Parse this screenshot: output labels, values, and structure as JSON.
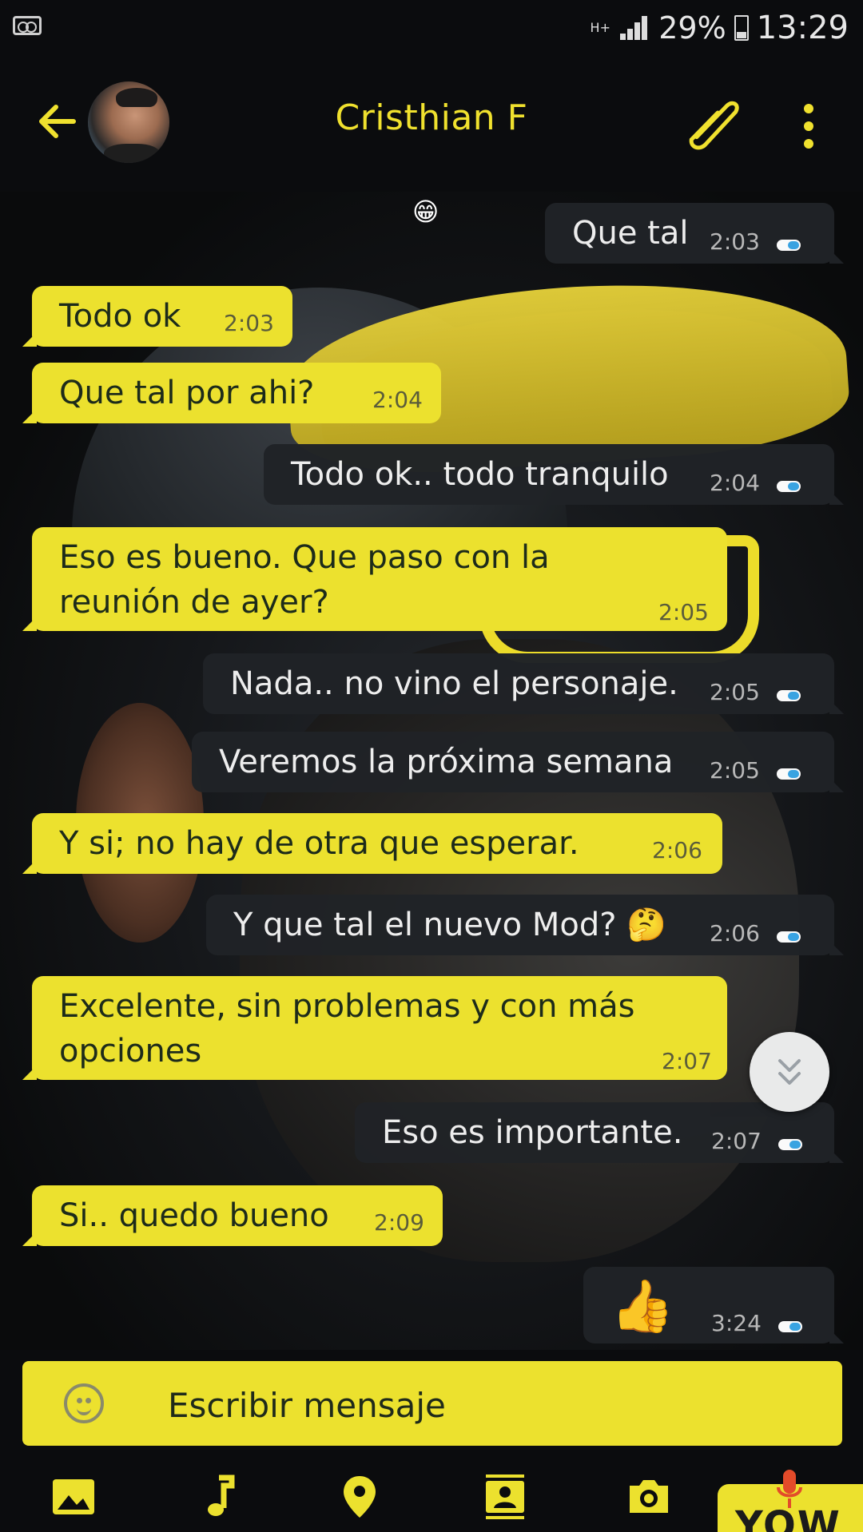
{
  "status_bar": {
    "network": "H+",
    "battery": "29%",
    "time": "13:29"
  },
  "header": {
    "contact_name": "Cristhian F"
  },
  "colors": {
    "accent_yellow": "#ece12e",
    "outgoing_bubble": "#202327",
    "read_tick_blue": "#3aa6e6"
  },
  "messages": [
    {
      "dir": "out",
      "text": "Que tal",
      "time": "2:03"
    },
    {
      "dir": "in",
      "text": "Todo ok",
      "time": "2:03"
    },
    {
      "dir": "in",
      "text": "Que tal por ahi?",
      "time": "2:04"
    },
    {
      "dir": "out",
      "text": "Todo ok.. todo tranquilo",
      "time": "2:04"
    },
    {
      "dir": "in",
      "text": "Eso es bueno. Que paso con la reunión de ayer?",
      "time": "2:05"
    },
    {
      "dir": "out",
      "text": "Nada.. no vino el personaje.",
      "time": "2:05"
    },
    {
      "dir": "out",
      "text": "Veremos la próxima semana",
      "time": "2:05"
    },
    {
      "dir": "in",
      "text": "Y si; no hay de otra que esperar.",
      "time": "2:06"
    },
    {
      "dir": "out",
      "text": "Y que tal el nuevo Mod? 🤔",
      "time": "2:06"
    },
    {
      "dir": "in",
      "text": "Excelente, sin problemas y con más opciones",
      "time": "2:07"
    },
    {
      "dir": "out",
      "text": "Eso es importante.",
      "time": "2:07"
    },
    {
      "dir": "in",
      "text": "Si.. quedo bueno",
      "time": "2:09"
    },
    {
      "dir": "out",
      "text": "👍",
      "time": "3:24"
    }
  ],
  "floating_emoji": "😁",
  "composer": {
    "placeholder": "Escribir mensaje"
  },
  "attach_bar": {
    "icons": [
      "image-icon",
      "music-icon",
      "location-icon",
      "contact-icon",
      "camera-icon",
      "microphone-icon"
    ],
    "brand_label": "YOW"
  }
}
